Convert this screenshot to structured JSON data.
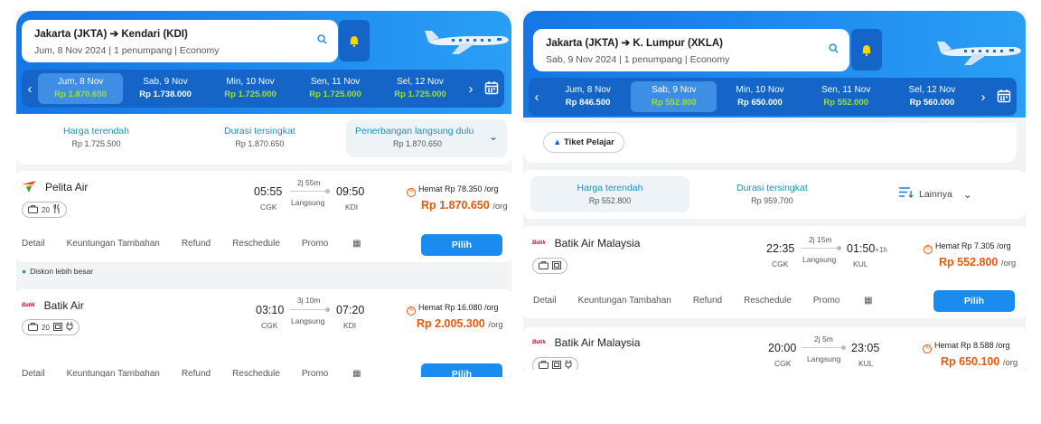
{
  "left": {
    "route": "Jakarta (JKTA) ➔ Kendari (KDI)",
    "subinfo": "Jum, 8 Nov 2024  |  1 penumpang  |  Economy",
    "dates": [
      {
        "day": "Jum, 8 Nov",
        "price": "Rp 1.870.650"
      },
      {
        "day": "Sab, 9 Nov",
        "price": "Rp 1.738.000"
      },
      {
        "day": "Min, 10 Nov",
        "price": "Rp 1.725.000"
      },
      {
        "day": "Sen, 11 Nov",
        "price": "Rp 1.725.000"
      },
      {
        "day": "Sel, 12 Nov",
        "price": "Rp 1.725.000"
      }
    ],
    "sort": [
      {
        "title": "Harga terendah",
        "value": "Rp 1.725.500"
      },
      {
        "title": "Durasi tersingkat",
        "value": "Rp 1.870.650"
      },
      {
        "title": "Penerbangan langsung dulu",
        "value": "Rp 1.870.650"
      }
    ],
    "flights": [
      {
        "airline": "Pelita Air",
        "baggage": "20",
        "dep": "05:55",
        "arr": "09:50",
        "from": "CGK",
        "to": "KDI",
        "duration": "2j 55m",
        "type": "Langsung",
        "hemat": "Hemat Rp 78.350 /org",
        "price": "Rp 1.870.650",
        "per": "/org"
      },
      {
        "airline": "Batik Air",
        "baggage": "20",
        "dep": "03:10",
        "arr": "07:20",
        "from": "CGK",
        "to": "KDI",
        "duration": "3j 10m",
        "type": "Langsung",
        "hemat": "Hemat Rp 16.080 /org",
        "price": "Rp 2.005.300",
        "per": "/org"
      }
    ],
    "diskon": "Diskon lebih besar"
  },
  "right": {
    "route": "Jakarta (JKTA) ➔ K. Lumpur (XKLA)",
    "subinfo": "Sab, 9 Nov 2024  |  1 penumpang  |  Economy",
    "dates": [
      {
        "day": "Jum, 8 Nov",
        "price": "Rp 846.500"
      },
      {
        "day": "Sab, 9 Nov",
        "price": "Rp 552.800"
      },
      {
        "day": "Min, 10 Nov",
        "price": "Rp 650.000"
      },
      {
        "day": "Sen, 11 Nov",
        "price": "Rp 552.000"
      },
      {
        "day": "Sel, 12 Nov",
        "price": "Rp 560.000"
      }
    ],
    "student_chip": "Tiket Pelajar",
    "sort": [
      {
        "title": "Harga terendah",
        "value": "Rp 552.800"
      },
      {
        "title": "Durasi tersingkat",
        "value": "Rp 959.700"
      },
      {
        "title": "Lainnya",
        "value": ""
      }
    ],
    "flights": [
      {
        "airline": "Batik Air Malaysia",
        "dep": "22:35",
        "arr": "01:50",
        "plus": "+1h",
        "from": "CGK",
        "to": "KUL",
        "duration": "2j 15m",
        "type": "Langsung",
        "hemat": "Hemat Rp 7.305 /org",
        "price": "Rp 552.800",
        "per": "/org"
      },
      {
        "airline": "Batik Air Malaysia",
        "dep": "20:00",
        "arr": "23:05",
        "plus": "",
        "from": "CGK",
        "to": "KUL",
        "duration": "2j 5m",
        "type": "Langsung",
        "hemat": "Hemat Rp 8.588 /org",
        "price": "Rp 650.100",
        "per": "/org"
      }
    ]
  },
  "tabs": {
    "detail": "Detail",
    "keuntungan": "Keuntungan Tambahan",
    "refund": "Refund",
    "reschedule": "Reschedule",
    "promo": "Promo"
  },
  "pilih": "Pilih",
  "colors": {
    "brand_blue": "#1a8cf0",
    "price_orange": "#e8590c",
    "cheap_green": "#9fe02e",
    "accent_teal": "#1a93b8"
  }
}
